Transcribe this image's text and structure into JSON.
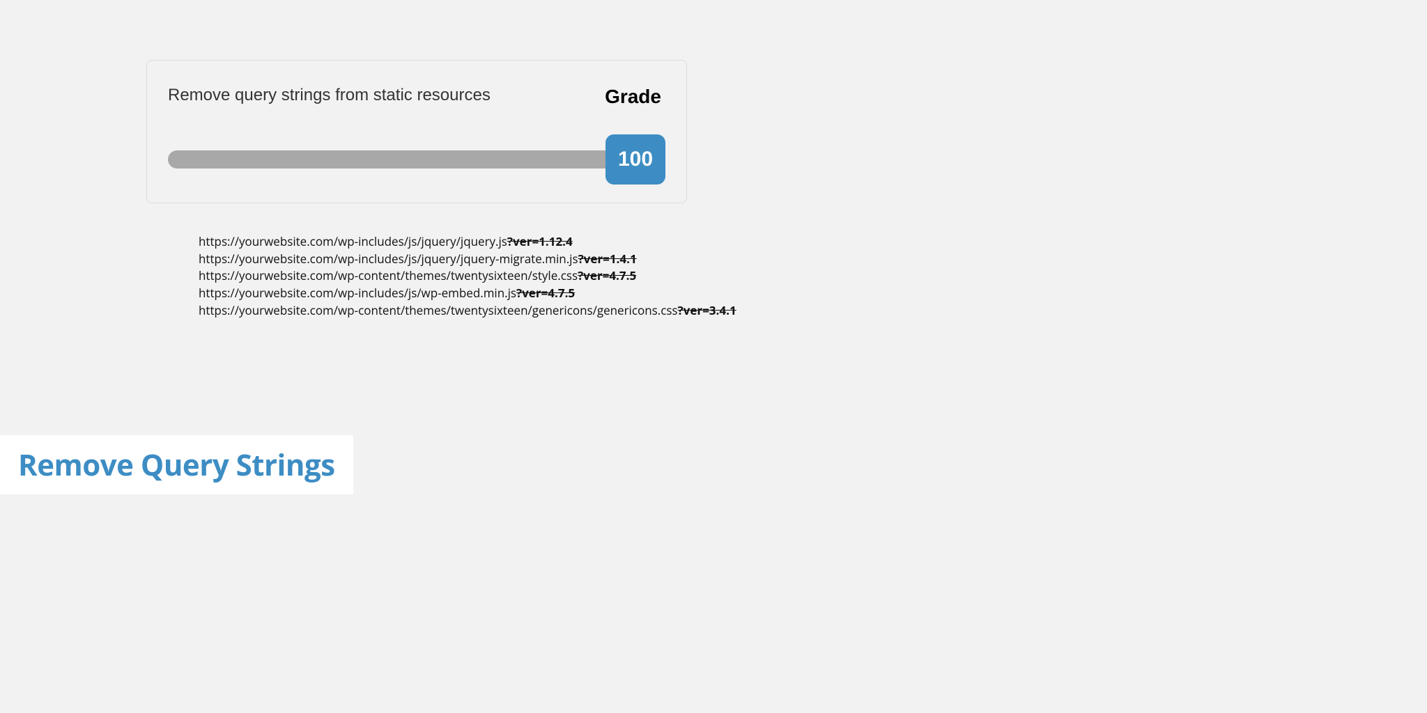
{
  "card": {
    "title": "Remove query strings from static resources",
    "grade_label": "Grade",
    "score": "100"
  },
  "urls": [
    {
      "base": "https://yourwebsite.com/wp-includes/js/jquery/jquery.js",
      "qs": "?ver=1.12.4"
    },
    {
      "base": "https://yourwebsite.com/wp-includes/js/jquery/jquery-migrate.min.js",
      "qs": "?ver=1.4.1"
    },
    {
      "base": "https://yourwebsite.com/wp-content/themes/twentysixteen/style.css",
      "qs": "?ver=4.7.5"
    },
    {
      "base": "https://yourwebsite.com/wp-includes/js/wp-embed.min.js",
      "qs": "?ver=4.7.5"
    },
    {
      "base": "https://yourwebsite.com/wp-content/themes/twentysixteen/genericons/genericons.css",
      "qs": "?ver=3.4.1"
    }
  ],
  "banner": {
    "title": "Remove Query Strings"
  }
}
